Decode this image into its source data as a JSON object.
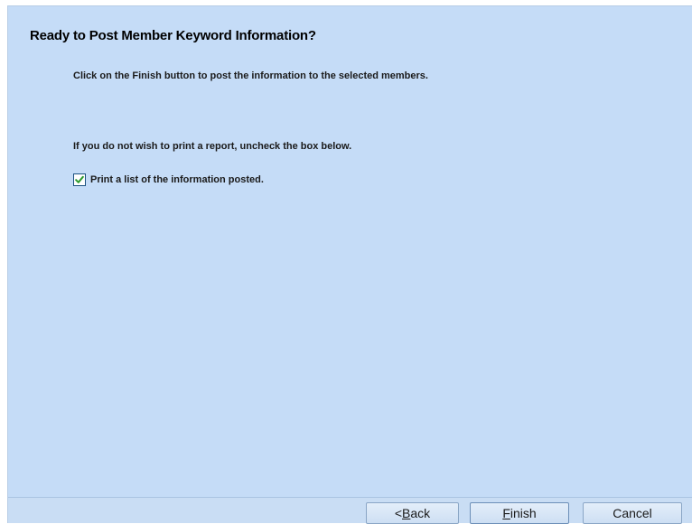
{
  "wizard": {
    "title": "Ready to Post Member Keyword Information?",
    "instruction_finish": "Click on the Finish button to post the information to the selected members.",
    "instruction_report": "If you do not wish to print a report, uncheck the box below.",
    "print_checkbox": {
      "label": "Print a list of the information posted.",
      "checked": true
    }
  },
  "buttons": {
    "back": {
      "prefix": "< ",
      "mnemonic": "B",
      "rest": "ack"
    },
    "finish": {
      "mnemonic": "F",
      "rest": "inish"
    },
    "cancel": {
      "label": "Cancel"
    }
  },
  "colors": {
    "panel_bg": "#c5dcf7",
    "check_mark": "#2e9a2e"
  },
  "icons": {
    "checkbox_mark": "check-icon"
  }
}
